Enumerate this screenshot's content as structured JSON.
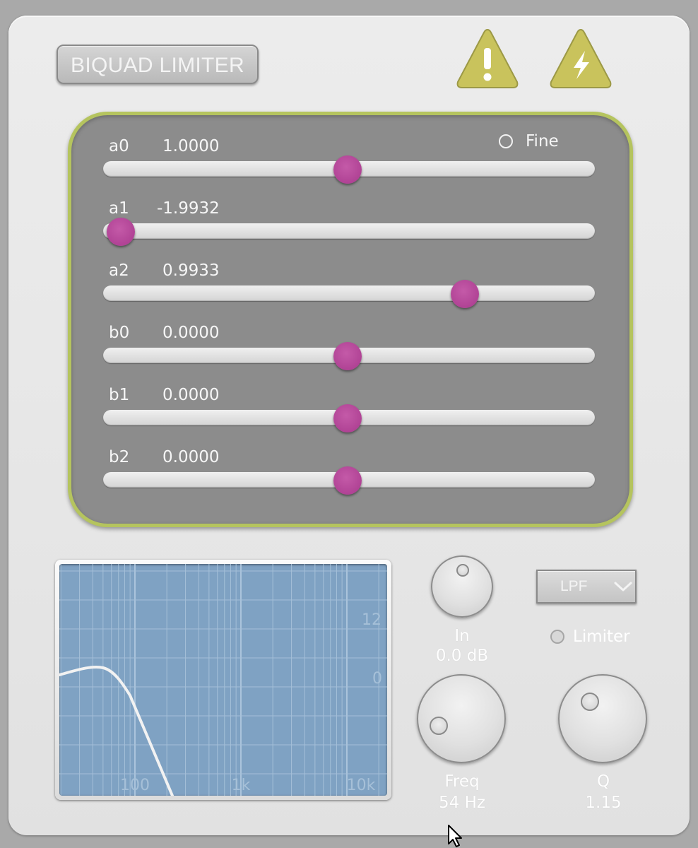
{
  "title": "BIQUAD LIMITER",
  "icons": {
    "warning": "warning-exclamation-icon",
    "power": "lightning-bolt-icon"
  },
  "coefficients": {
    "fine_label": "Fine",
    "rows": [
      {
        "name": "a0",
        "value": "1.0000",
        "position": 0.497
      },
      {
        "name": "a1",
        "value": "-1.9932",
        "position": 0.036
      },
      {
        "name": "a2",
        "value": "0.9933",
        "position": 0.735
      },
      {
        "name": "b0",
        "value": "0.0000",
        "position": 0.497
      },
      {
        "name": "b1",
        "value": "0.0000",
        "position": 0.497
      },
      {
        "name": "b2",
        "value": "0.0000",
        "position": 0.497
      }
    ]
  },
  "graph": {
    "x_ticks": [
      "100",
      "1k",
      "10k"
    ],
    "y_ticks": [
      "12",
      "0"
    ]
  },
  "controls": {
    "in_label": "In",
    "in_value": "0.0 dB",
    "freq_label": "Freq",
    "freq_value": "54 Hz",
    "q_label": "Q",
    "q_value": "1.15",
    "filter_type": "LPF",
    "limiter_label": "Limiter"
  },
  "colors": {
    "accent": "#b5c45e",
    "thumb": "#b44a9b",
    "warning": "#c9c35c",
    "graph_bg": "#7fa2c3"
  }
}
